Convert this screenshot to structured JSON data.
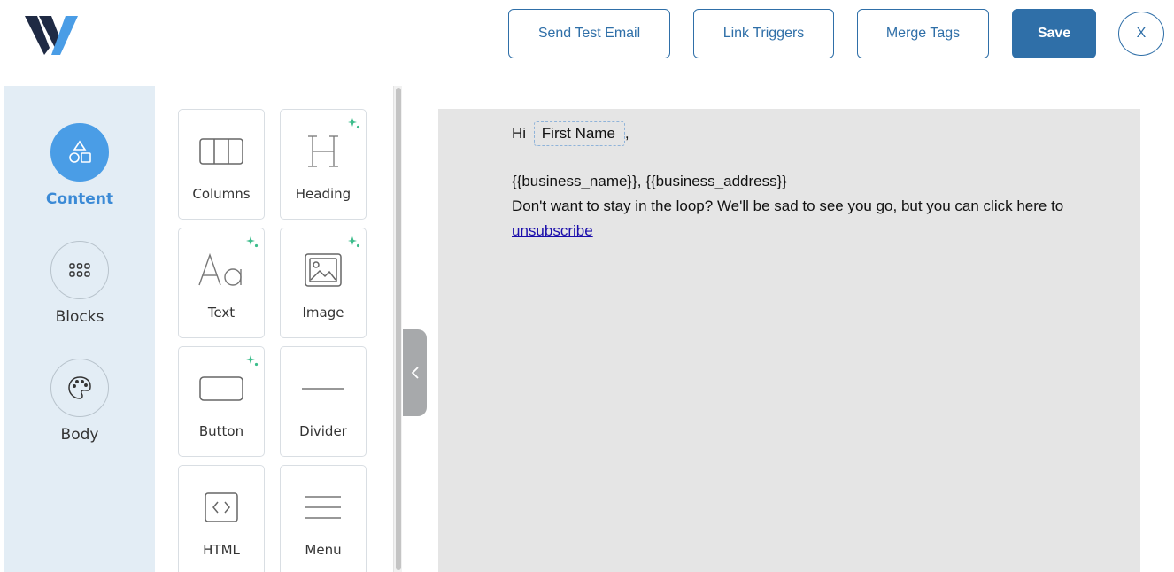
{
  "header": {
    "send_test_email": "Send Test Email",
    "link_triggers": "Link Triggers",
    "merge_tags": "Merge Tags",
    "save": "Save",
    "close": "X"
  },
  "sidebar": {
    "items": [
      {
        "label": "Content",
        "icon": "shapes-icon",
        "active": true
      },
      {
        "label": "Blocks",
        "icon": "grid-icon",
        "active": false
      },
      {
        "label": "Body",
        "icon": "palette-icon",
        "active": false
      }
    ]
  },
  "tools": [
    {
      "label": "Columns",
      "icon": "columns-icon",
      "ai": false
    },
    {
      "label": "Heading",
      "icon": "heading-icon",
      "ai": true
    },
    {
      "label": "Text",
      "icon": "text-icon",
      "ai": true
    },
    {
      "label": "Image",
      "icon": "image-icon",
      "ai": true
    },
    {
      "label": "Button",
      "icon": "button-icon",
      "ai": true
    },
    {
      "label": "Divider",
      "icon": "divider-icon",
      "ai": false
    },
    {
      "label": "HTML",
      "icon": "code-icon",
      "ai": false
    },
    {
      "label": "Menu",
      "icon": "menu-icon",
      "ai": false
    }
  ],
  "email": {
    "greeting": "Hi",
    "merge_tag": "First Name",
    "comma": ",",
    "footer_vars": "{{business_name}}, {{business_address}}",
    "unsub_text": "Don't want to stay in the loop? We'll be sad to see you go, but you can click here to",
    "unsub_link": "unsubscribe"
  },
  "colors": {
    "accent": "#2f6fa8",
    "active_nav": "#4a9de6",
    "sparkle": "#3dbd8c",
    "canvas_bg": "#e5e5e5",
    "nav_bg": "#e3edf5"
  }
}
